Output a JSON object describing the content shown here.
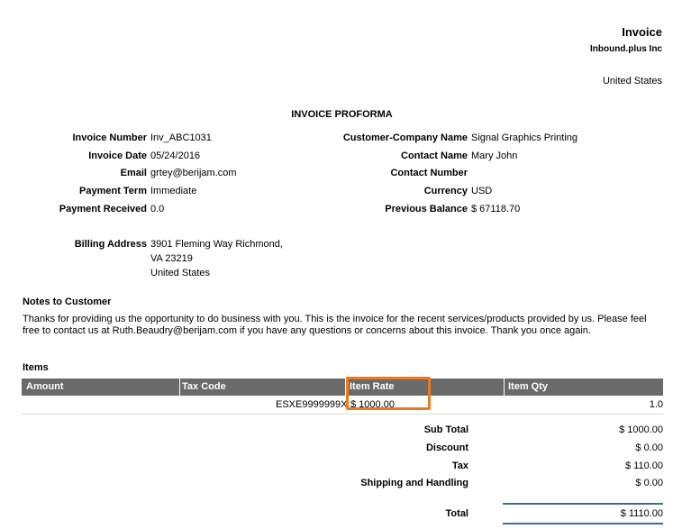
{
  "header": {
    "title": "Invoice",
    "company": "Inbound.plus Inc",
    "country": "United States"
  },
  "doc_title": "INVOICE PROFORMA",
  "left_fields": [
    {
      "label": "Invoice Number",
      "value": "Inv_ABC1031"
    },
    {
      "label": "Invoice Date",
      "value": "05/24/2016"
    },
    {
      "label": "Email",
      "value": "grtey@berijam.com"
    },
    {
      "label": "Payment Term",
      "value": "Immediate"
    },
    {
      "label": "Payment Received",
      "value": "0.0"
    }
  ],
  "right_fields": [
    {
      "label": "Customer-Company Name",
      "value": "Signal Graphics Printing"
    },
    {
      "label": "Contact Name",
      "value": "Mary John"
    },
    {
      "label": "Contact Number",
      "value": ""
    },
    {
      "label": "Currency",
      "value": "USD"
    },
    {
      "label": "Previous Balance",
      "value": "$ 67118.70"
    }
  ],
  "billing": {
    "label": "Billing Address",
    "line1": "3901 Fleming Way Richmond,",
    "line2": "VA 23219",
    "line3": "United States"
  },
  "notes": {
    "heading": "Notes to Customer",
    "line1": "Thanks for providing us the opportunity to do business with you. This is the invoice for the recent services/products provided by us. Please feel",
    "line2": "free to contact us at Ruth.Beaudry@berijam.com if you have any questions or concerns about this invoice. Thank you once again."
  },
  "items": {
    "heading": "Items",
    "columns": [
      "Amount",
      "Tax Code",
      "Item Rate",
      "Item Qty"
    ],
    "rows": [
      {
        "amount": "",
        "tax_code": "ESXE9999999X",
        "item_rate": "$ 1000.00",
        "item_qty": "1.0"
      }
    ]
  },
  "totals": [
    {
      "label": "Sub Total",
      "value": "$ 1000.00"
    },
    {
      "label": "Discount",
      "value": "$ 0.00"
    },
    {
      "label": "Tax",
      "value": "$ 110.00"
    },
    {
      "label": "Shipping and Handling",
      "value": "$ 0.00"
    }
  ],
  "grand_total": {
    "label": "Total",
    "value": "$ 1110.00"
  },
  "colors": {
    "header_bg": "#6a6a6a",
    "highlight": "#f07a1a",
    "total_rule": "#3b6ea8"
  }
}
